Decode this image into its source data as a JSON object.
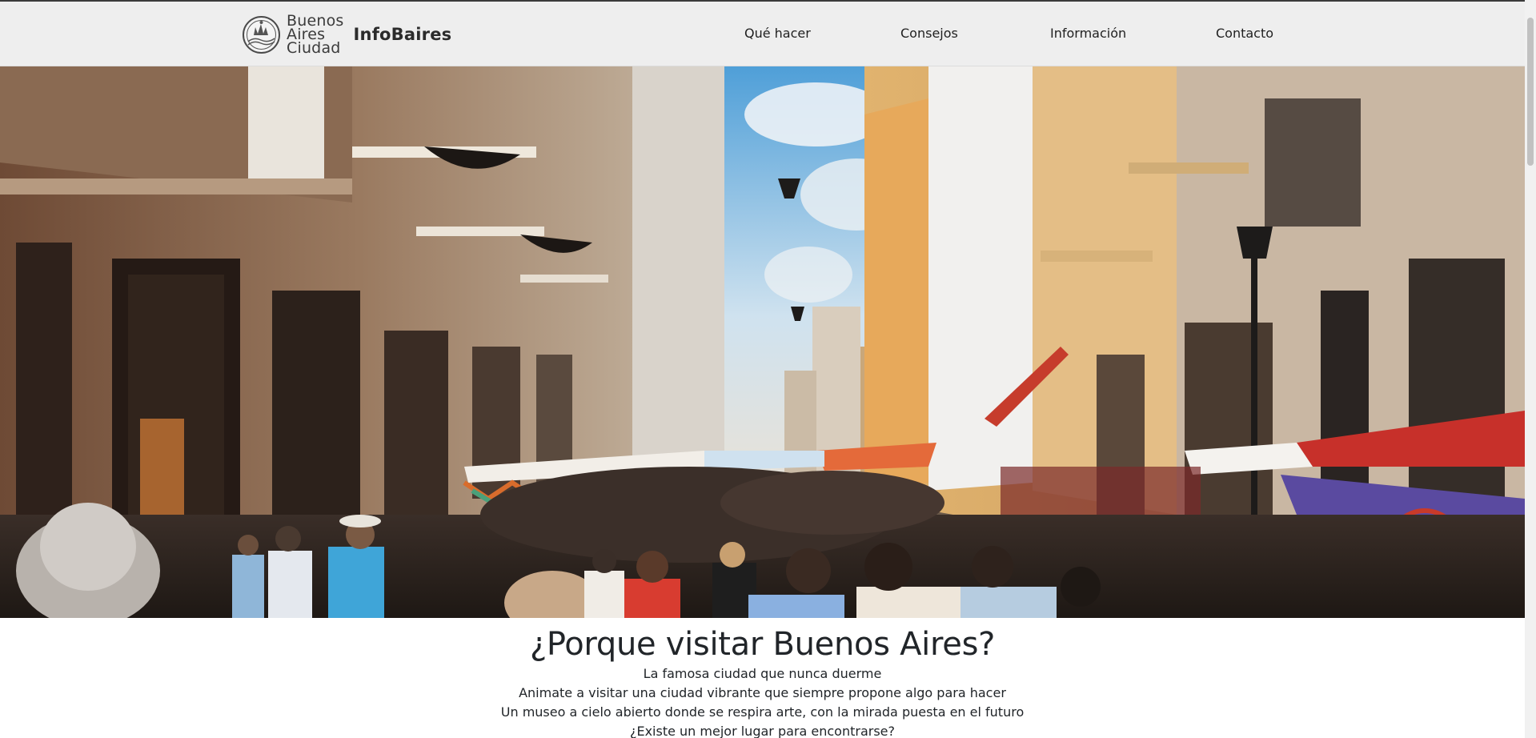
{
  "brand": {
    "logo_lines": [
      "Buenos",
      "Aires",
      "Ciudad"
    ],
    "site_name": "InfoBaires"
  },
  "nav": {
    "items": [
      {
        "label": "Qué hacer"
      },
      {
        "label": "Consejos"
      },
      {
        "label": "Información"
      },
      {
        "label": "Contacto"
      }
    ]
  },
  "hero": {
    "alt": "Calle de San Telmo con feria y multitud"
  },
  "intro": {
    "title": "¿Porque visitar Buenos Aires?",
    "lines": [
      "La famosa ciudad que nunca duerme",
      "Animate a visitar una ciudad vibrante que siempre propone algo para hacer",
      "Un museo a cielo abierto donde se respira arte, con la mirada puesta en el futuro",
      "¿Existe un mejor lugar para encontrarse?"
    ]
  },
  "colors": {
    "navbar_bg": "#eeeeee",
    "text": "#212529"
  }
}
